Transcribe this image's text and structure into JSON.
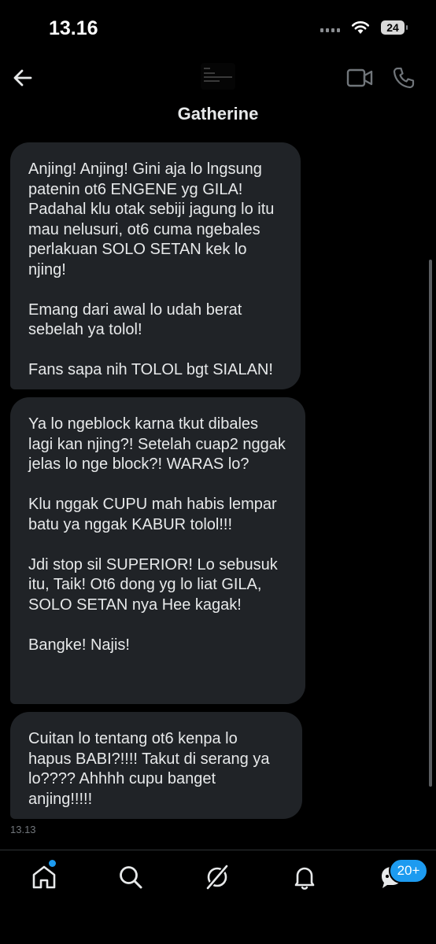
{
  "status_bar": {
    "time": "13.16",
    "battery": "24"
  },
  "header": {
    "contact_name": "Gatherine"
  },
  "messages": [
    {
      "text": "Anjing! Anjing! Gini aja lo lngsung patenin ot6 ENGENE yg GILA! Padahal klu otak sebiji jagung lo itu mau nelusuri, ot6 cuma ngebales perlakuan SOLO SETAN kek lo njing!\n\nEmang dari awal lo udah berat sebelah ya tolol!\n\nFans sapa nih TOLOL bgt SIALAN!"
    },
    {
      "text": "Ya lo ngeblock karna tkut dibales lagi kan njing?! Setelah cuap2 nggak jelas lo nge block?! WARAS lo?\n\nKlu nggak CUPU mah habis lempar batu ya nggak KABUR tolol!!!\n\nJdi stop sil SUPERIOR! Lo sebusuk itu, Taik! Ot6 dong yg lo liat GILA, SOLO SETAN nya Hee kagak!\n\nBangke! Najis!"
    },
    {
      "text": "Cuitan lo tentang ot6 kenpa lo hapus BABI?!!!! Takut di serang ya lo???? Ahhhh cupu banget anjing!!!!!"
    }
  ],
  "last_timestamp": "13.13",
  "bottom_nav": {
    "items": [
      "home-icon",
      "search-icon",
      "grok-icon",
      "notifications-icon",
      "messages-icon"
    ],
    "messages_badge": "20+"
  },
  "colors": {
    "accent": "#1d9bf0",
    "bubble": "#202327",
    "background": "#000000",
    "text": "#e7e9ea",
    "muted": "#71767b"
  }
}
